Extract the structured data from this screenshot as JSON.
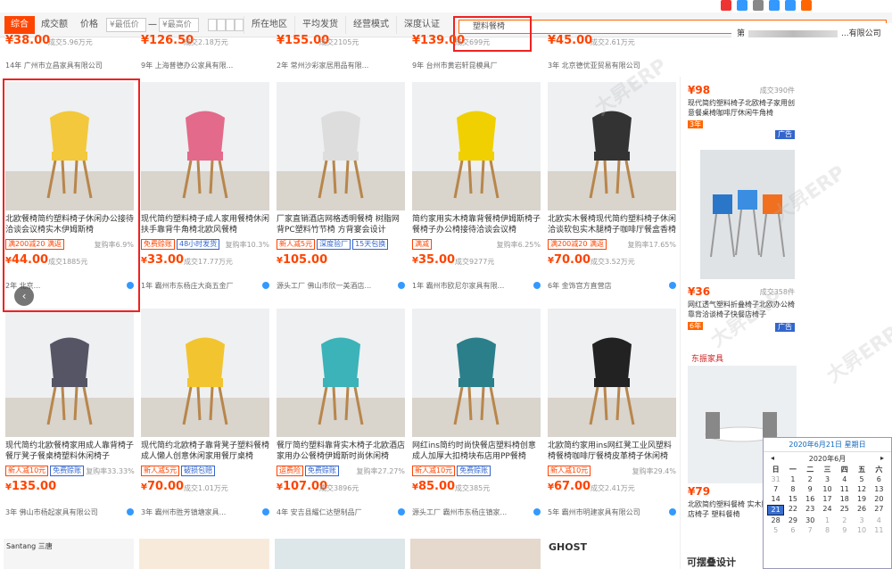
{
  "filter": {
    "tabs": [
      "综合",
      "成交额",
      "价格"
    ],
    "min_price_placeholder": "¥最低价",
    "max_price_placeholder": "¥最高价",
    "dash": "—",
    "dropdowns": [
      "所在地区",
      "平均发货",
      "经营模式",
      "深度认证"
    ],
    "search_value": "塑料餐椅"
  },
  "browser": {
    "company_suffix": "...有限公司",
    "prefix": "第"
  },
  "top_row": [
    {
      "price": "¥38.00",
      "sales": "成交5.96万元",
      "shop": "14年 广州市立昌家具有限公司"
    },
    {
      "price": "¥126.50",
      "sales": "成交2.18万元",
      "shop": "9年 上海普德办公家具有限..."
    },
    {
      "price": "¥155.00",
      "sales": "成交2105元",
      "shop": "2年 常州沙彩家居用品有限..."
    },
    {
      "price": "¥139.00",
      "sales": "成交699元",
      "shop": "9年 台州市黄岩轩昆模具厂"
    },
    {
      "price": "¥45.00",
      "sales": "成交2.61万元",
      "shop": "3年 北京德优亚贸易有限公司"
    }
  ],
  "products": [
    {
      "title": "北欧餐椅简约塑料椅子休闲办公接待洽谈会议椅实木伊姆斯椅",
      "tags": [
        "满200减20 满返"
      ],
      "rate": "复购率6.9%",
      "price": "44.00",
      "sales": "成交1885元",
      "shop": "2年 北京...",
      "color": "#f3c83c"
    },
    {
      "title": "现代简约塑料椅子成人家用餐椅休闲扶手靠背牛角椅北欧风餐椅",
      "tags": [
        "免费赊账",
        "48小时发货"
      ],
      "rate": "复购率10.3%",
      "price": "33.00",
      "sales": "成交17.77万元",
      "shop": "1年 霸州市东杨庄大商五金厂",
      "color": "#e36a8a"
    },
    {
      "title": "厂家直销酒店网格透明餐椅 树脂网背PC塑料竹节椅 方背宴会设计",
      "tags": [
        "新人减5元",
        "深度验厂",
        "15天包换"
      ],
      "rate": "",
      "price": "105.00",
      "sales": "",
      "shop": "源头工厂 佛山市欣一美酒店...",
      "color": "#ddd"
    },
    {
      "title": "简约家用实木椅靠背餐椅伊姆斯椅子餐椅子办公椅接待洽谈会议椅",
      "tags": [
        "满减"
      ],
      "rate": "复购率6.25%",
      "price": "35.00",
      "sales": "成交9277元",
      "shop": "1年 霸州市欧尼尔家具有限...",
      "color": "#f0d000"
    },
    {
      "title": "北欧实木餐椅现代简约塑料椅子休闲洽谈软包实木腿椅子咖啡厅餐盒香椅",
      "tags": [
        "满200减20 满返"
      ],
      "rate": "复购率17.65%",
      "price": "70.00",
      "sales": "成交3.52万元",
      "shop": "6年 金饰宫方直营店",
      "color": "#333"
    },
    {
      "title": "现代简约北欧餐椅家用成人靠背椅子餐厅凳子餐桌椅塑料休闲椅子",
      "tags": [
        "新人减10元",
        "免费赊账"
      ],
      "rate": "复购率33.33%",
      "price": "135.00",
      "sales": "",
      "shop": "3年 佛山市杨起家具有限公司",
      "color": "#556"
    },
    {
      "title": "现代简约北欧椅子靠背凳子塑料餐椅成人懒人创意休闲家用餐厅桌椅",
      "tags": [
        "新人减5元",
        "破损包赔"
      ],
      "rate": "",
      "price": "70.00",
      "sales": "成交1.01万元",
      "shop": "3年 霸州市胜芳镇塘家具...",
      "color": "#f2c430"
    },
    {
      "title": "餐厅简约塑料靠背实木椅子北欧酒店家用办公餐椅伊姆斯时尚休闲椅",
      "tags": [
        "运费险",
        "免费赊账"
      ],
      "rate": "复购率27.27%",
      "price": "107.00",
      "sales": "成交3896元",
      "shop": "4年 安吉县耀仁达塑制品厂",
      "color": "#3bb3b8"
    },
    {
      "title": "网红ins简约时尚快餐店塑料椅创意成人加厚大扣椅块布店用PP餐椅",
      "tags": [
        "新人减10元",
        "免费赊账"
      ],
      "rate": "",
      "price": "85.00",
      "sales": "成交385元",
      "shop": "源头工厂 霸州市东杨庄镇家...",
      "color": "#2a7f8a"
    },
    {
      "title": "北欧简约家用ins网红凳工业风塑料椅餐椅咖啡厅餐椅皮革椅子休闲椅",
      "tags": [
        "新人减10元"
      ],
      "rate": "复购率29.4%",
      "price": "67.00",
      "sales": "成交2.41万元",
      "shop": "5年 霸州市明建家具有限公司",
      "color": "#222"
    }
  ],
  "sidebar": [
    {
      "price": "¥98",
      "sales": "成交390件",
      "title": "现代简约塑料椅子北欧椅子家用创意餐桌椅咖啡厅休闲牛角椅",
      "ad": "广告",
      "years": "3年",
      "color": "#444"
    },
    {
      "price": "¥36",
      "sales": "成交358件",
      "title": "网红透气塑料折叠椅子北欧办公椅靠背洽谈椅子快餐店椅子",
      "ad": "广告",
      "years": "6年",
      "color": "#2a77c9"
    },
    {
      "price": "¥79",
      "sales": "",
      "title": "北欧简约塑料餐椅 实木腿办公...店椅子 塑料餐椅",
      "ad": "广告",
      "years": "",
      "color": "#eee",
      "brand": "东振家具"
    }
  ],
  "sidebar_bottom": "可摆叠设计",
  "calendar": {
    "header": "2020年6月21日 星期日",
    "month": "2020年6月",
    "weekdays": [
      "日",
      "一",
      "二",
      "三",
      "四",
      "五",
      "六"
    ],
    "rows": [
      [
        "31",
        "1",
        "2",
        "3",
        "4",
        "5",
        "6"
      ],
      [
        "7",
        "8",
        "9",
        "10",
        "11",
        "12",
        "13"
      ],
      [
        "14",
        "15",
        "16",
        "17",
        "18",
        "19",
        "20"
      ],
      [
        "21",
        "22",
        "23",
        "24",
        "25",
        "26",
        "27"
      ],
      [
        "28",
        "29",
        "30",
        "1",
        "2",
        "3",
        "4"
      ],
      [
        "5",
        "6",
        "7",
        "8",
        "9",
        "10",
        "11"
      ]
    ]
  },
  "bottom_brands": [
    "Santang 三唐",
    "GHOST"
  ],
  "watermark": "大昇ERP",
  "colors": {
    "accent": "#ff4400",
    "highlight": "#e62222",
    "link": "#3366cc"
  }
}
